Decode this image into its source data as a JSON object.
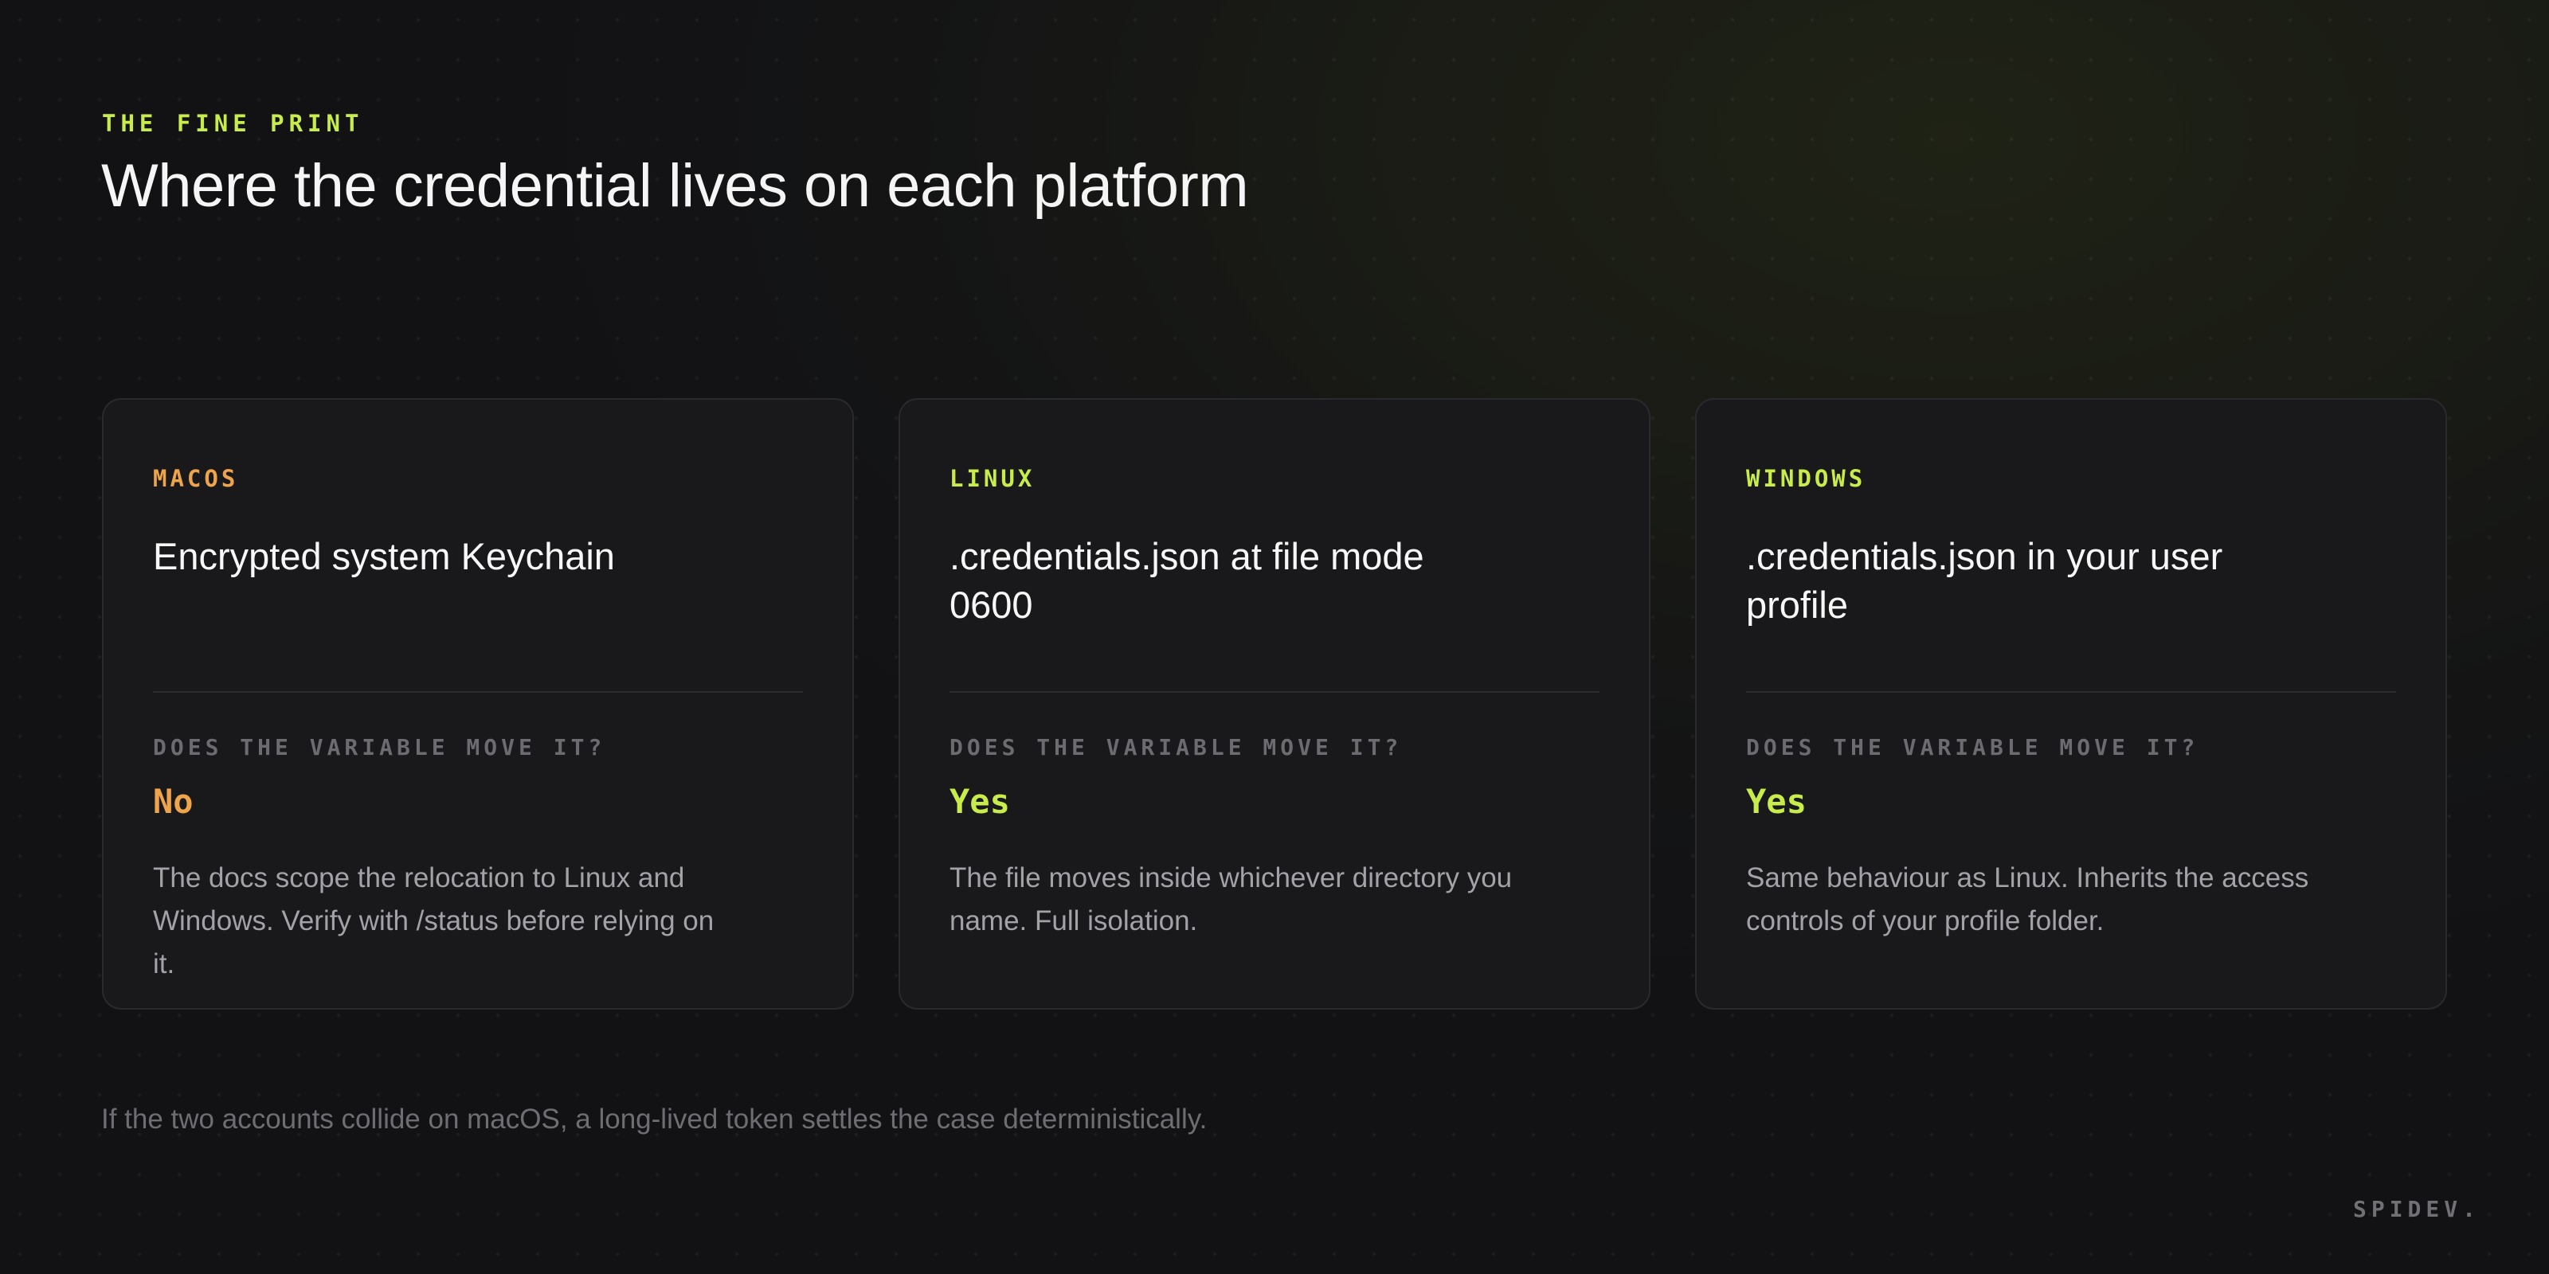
{
  "header": {
    "eyebrow": "THE FINE PRINT",
    "title": "Where the credential lives on each platform"
  },
  "cards": [
    {
      "platform": "MACOS",
      "location": "Encrypted system Keychain",
      "question": "DOES THE VARIABLE MOVE IT?",
      "answer": "No",
      "description": "The docs scope the relocation to Linux and Windows. Verify with /status before relying on it.",
      "accent": "#eda44a"
    },
    {
      "platform": "LINUX",
      "location": ".credentials.json at file mode 0600",
      "question": "DOES THE VARIABLE MOVE IT?",
      "answer": "Yes",
      "description": "The file moves inside whichever directory you name. Full isolation.",
      "accent": "#c8ec4a"
    },
    {
      "platform": "WINDOWS",
      "location": ".credentials.json in your user profile",
      "question": "DOES THE VARIABLE MOVE IT?",
      "answer": "Yes",
      "description": "Same behaviour as Linux. Inherits the access controls of your profile folder.",
      "accent": "#c8ec4a"
    }
  ],
  "footer": {
    "note": "If the two accounts collide on macOS, a long-lived token settles the case deterministically.",
    "brand": "SPIDEV."
  }
}
